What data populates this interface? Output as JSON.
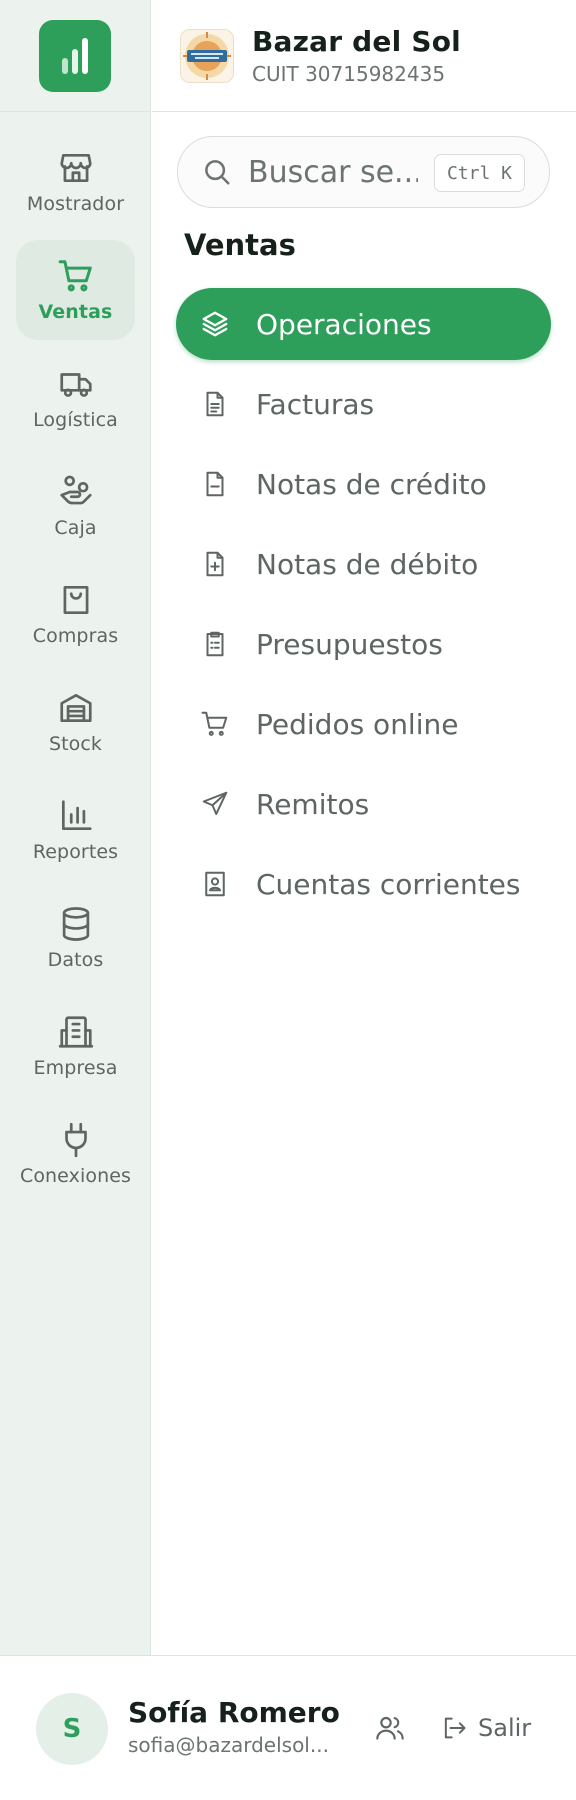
{
  "colors": {
    "accent": "#2e9e5b",
    "rail_bg": "#ecf2ee",
    "text_muted": "#5d6661"
  },
  "rail": {
    "logo_icon": "bar-chart-icon",
    "items": [
      {
        "label": "Mostrador",
        "icon": "store-icon",
        "active": false
      },
      {
        "label": "Ventas",
        "icon": "cart-icon",
        "active": true
      },
      {
        "label": "Logística",
        "icon": "truck-icon",
        "active": false
      },
      {
        "label": "Caja",
        "icon": "hand-coins-icon",
        "active": false
      },
      {
        "label": "Compras",
        "icon": "shopping-bag-icon",
        "active": false
      },
      {
        "label": "Stock",
        "icon": "warehouse-icon",
        "active": false
      },
      {
        "label": "Reportes",
        "icon": "bar-chart-icon",
        "active": false
      },
      {
        "label": "Datos",
        "icon": "database-icon",
        "active": false
      },
      {
        "label": "Empresa",
        "icon": "building-icon",
        "active": false
      },
      {
        "label": "Conexiones",
        "icon": "plug-icon",
        "active": false
      }
    ]
  },
  "header": {
    "store_name": "Bazar del Sol",
    "store_cuit": "CUIT 30715982435",
    "logo_text": "BAZAR DEL SOL"
  },
  "search": {
    "placeholder": "Buscar se...",
    "shortcut": "Ctrl K"
  },
  "section": {
    "title": "Ventas"
  },
  "menu": {
    "items": [
      {
        "label": "Operaciones",
        "icon": "layers-icon",
        "active": true
      },
      {
        "label": "Facturas",
        "icon": "file-text-icon",
        "active": false
      },
      {
        "label": "Notas de crédito",
        "icon": "file-minus-icon",
        "active": false
      },
      {
        "label": "Notas de débito",
        "icon": "file-plus-icon",
        "active": false
      },
      {
        "label": "Presupuestos",
        "icon": "clipboard-list-icon",
        "active": false
      },
      {
        "label": "Pedidos online",
        "icon": "cart-icon",
        "active": false
      },
      {
        "label": "Remitos",
        "icon": "send-icon",
        "active": false
      },
      {
        "label": "Cuentas corrientes",
        "icon": "contact-book-icon",
        "active": false
      }
    ]
  },
  "user": {
    "initial": "S",
    "name": "Sofía Romero",
    "email": "sofia@bazardelsol..."
  },
  "footer": {
    "team_icon": "users-icon",
    "logout_label": "Salir",
    "logout_icon": "logout-icon"
  }
}
